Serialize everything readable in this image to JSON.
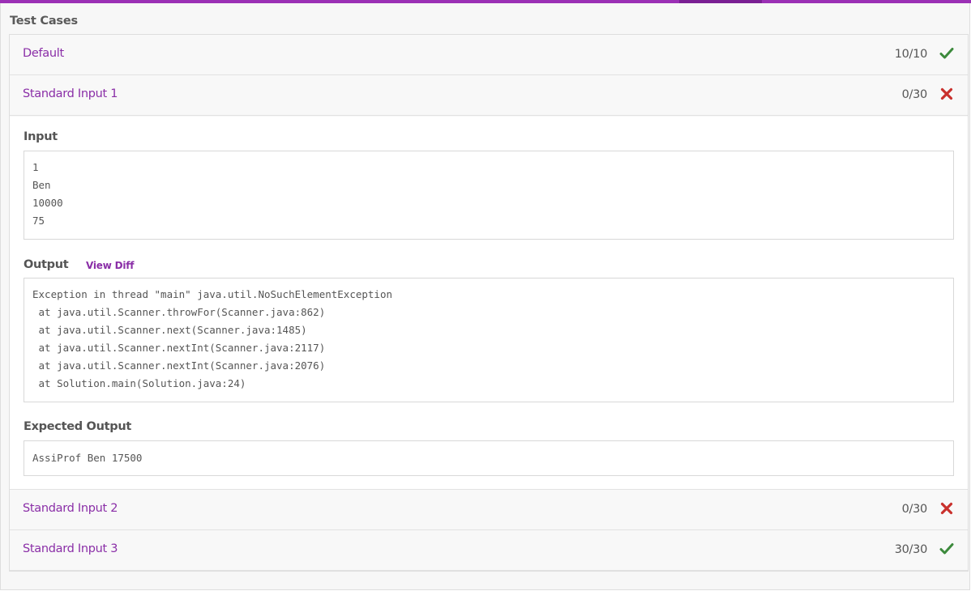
{
  "panel": {
    "title": "Test Cases"
  },
  "cases": [
    {
      "name": "Default",
      "score": "10/10",
      "status": "pass",
      "status_icon": "check-icon"
    },
    {
      "name": "Standard Input 1",
      "score": "0/30",
      "status": "fail",
      "status_icon": "cross-icon"
    },
    {
      "name": "Standard Input 2",
      "score": "0/30",
      "status": "fail",
      "status_icon": "cross-icon"
    },
    {
      "name": "Standard Input 3",
      "score": "30/30",
      "status": "pass",
      "status_icon": "check-icon"
    }
  ],
  "detail": {
    "input_label": "Input",
    "input_lines": [
      "1",
      "Ben",
      "10000",
      "75"
    ],
    "output_label": "Output",
    "view_diff_label": "View Diff",
    "output_lines": [
      "Exception in thread \"main\" java.util.NoSuchElementException",
      " at java.util.Scanner.throwFor(Scanner.java:862)",
      " at java.util.Scanner.next(Scanner.java:1485)",
      " at java.util.Scanner.nextInt(Scanner.java:2117)",
      " at java.util.Scanner.nextInt(Scanner.java:2076)",
      " at Solution.main(Solution.java:24)"
    ],
    "expected_label": "Expected Output",
    "expected_lines": [
      "AssiProf Ben 17500"
    ]
  },
  "colors": {
    "accent": "#9b30b5",
    "link": "#8a2ea7",
    "pass": "#3c8a3c",
    "fail": "#c9302c"
  }
}
